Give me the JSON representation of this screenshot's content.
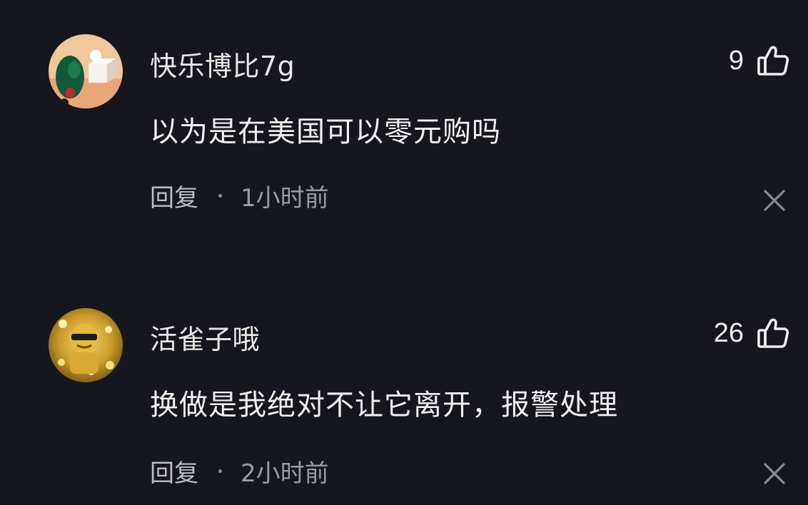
{
  "colors": {
    "background": "#16161e",
    "primary_text": "#f1f1f1",
    "secondary_text": "#9a9aa2"
  },
  "comments": [
    {
      "username": "快乐博比7g",
      "text": "以为是在美国可以零元购吗",
      "reply_label": "回复",
      "time": "1小时前",
      "likes": "9",
      "avatar_icon": "avatar-parrot-cube",
      "like_icon": "thumbs-up-icon",
      "dismiss_icon": "close-icon"
    },
    {
      "username": "活雀子哦",
      "text": "换做是我绝对不让它离开，报警处理",
      "reply_label": "回复",
      "time": "2小时前",
      "likes": "26",
      "avatar_icon": "avatar-gold-sunglasses",
      "like_icon": "thumbs-up-icon",
      "dismiss_icon": "close-icon"
    }
  ]
}
